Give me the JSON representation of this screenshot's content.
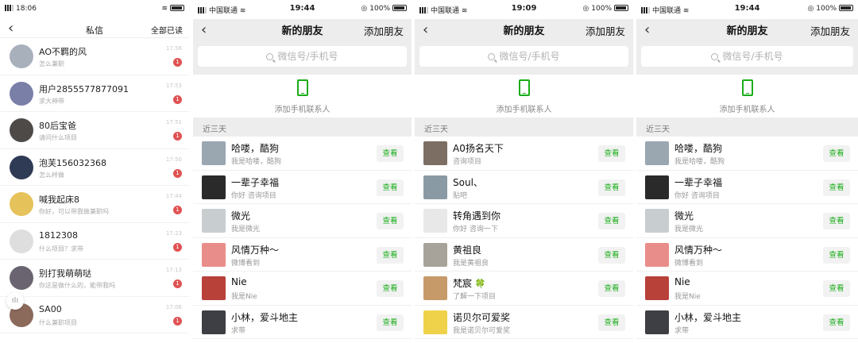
{
  "colors": {
    "wechat_green": "#1aad19",
    "badge_red": "#e05353",
    "section_bg": "#ededed"
  },
  "messages_screen": {
    "status": {
      "time": "18:06",
      "carrier": "4G"
    },
    "title": "私信",
    "back_icon": "chevron-left-icon",
    "mark_all_read": "全部已读",
    "items": [
      {
        "name": "AO不羁的风",
        "subtitle": "怎么兼职",
        "time": "17:56",
        "badge": "1",
        "avatar": "#a8b0bc"
      },
      {
        "name": "用户2855577877091",
        "subtitle": "求大神带",
        "time": "17:53",
        "badge": "1",
        "avatar": "#7a7fa8"
      },
      {
        "name": "80后宝爸",
        "subtitle": "请问什么项目",
        "time": "17:51",
        "badge": "1",
        "avatar": "#4e4a48"
      },
      {
        "name": "泡芙156032368",
        "subtitle": "怎么样做",
        "time": "17:50",
        "badge": "1",
        "avatar": "#2f3a55"
      },
      {
        "name": "喊我起床8",
        "subtitle": "你好，可以带我做兼职吗",
        "time": "17:44",
        "badge": "1",
        "avatar": "#e6c25a"
      },
      {
        "name": "1812308",
        "subtitle": "什么项目？求带",
        "time": "17:23",
        "badge": "1",
        "avatar": "#dedede"
      },
      {
        "name": "别打我萌萌哒",
        "subtitle": "你这是做什么的，能带我吗",
        "time": "17:13",
        "badge": "1",
        "avatar": "#6a6470"
      },
      {
        "name": "SA00",
        "subtitle": "什么兼职项目",
        "time": "17:06",
        "badge": "1",
        "avatar": "#8b6a5c"
      }
    ]
  },
  "new_friends_screens": [
    {
      "status": {
        "carrier": "中国联通",
        "time": "19:44",
        "battery": "100%"
      },
      "title": "新的朋友",
      "add_friend": "添加朋友",
      "search_placeholder": "微信号/手机号",
      "add_contacts": "添加手机联系人",
      "section": "近三天",
      "view_label": "查看",
      "friends": [
        {
          "name": "哈喽，酷狗",
          "note": "我是哈喽，酷狗",
          "avatar": "#9aa6b0"
        },
        {
          "name": "一辈子幸福",
          "note": "你好 咨询项目",
          "avatar": "#2a2a2a"
        },
        {
          "name": "微光",
          "note": "我是微光",
          "avatar": "#c8cdd0"
        },
        {
          "name": "风情万种～",
          "note": "微博看到",
          "avatar": "#e98d8a"
        },
        {
          "name": "Nie",
          "note": "我是Nie",
          "avatar": "#b8413a"
        },
        {
          "name": "小林，爱斗地主",
          "note": "求带",
          "avatar": "#3d3f44"
        }
      ]
    },
    {
      "status": {
        "carrier": "中国联通",
        "time": "19:09",
        "battery": "100%"
      },
      "title": "新的朋友",
      "add_friend": "添加朋友",
      "search_placeholder": "微信号/手机号",
      "add_contacts": "添加手机联系人",
      "section": "近三天",
      "view_label": "查看",
      "friends": [
        {
          "name": "A0扬名天下",
          "note": "咨询项目",
          "avatar": "#7c6e62"
        },
        {
          "name": "Soul、",
          "note": "贴吧",
          "avatar": "#8a9aa4"
        },
        {
          "name": "转角遇到你",
          "note": "你好 咨询一下",
          "avatar": "#e8e8e8"
        },
        {
          "name": "黄祖良",
          "note": "我是黄祖良",
          "avatar": "#a7a39a"
        },
        {
          "name": "梵宸",
          "note": "了解一下项目",
          "avatar": "#c79a6a",
          "emoji": "🍀"
        },
        {
          "name": "诺贝尔可爱奖",
          "note": "我是诺贝尔可爱奖",
          "avatar": "#f0d24a"
        }
      ]
    },
    {
      "status": {
        "carrier": "中国联通",
        "time": "19:44",
        "battery": "100%"
      },
      "title": "新的朋友",
      "add_friend": "添加朋友",
      "search_placeholder": "微信号/手机号",
      "add_contacts": "添加手机联系人",
      "section": "近三天",
      "view_label": "查看",
      "friends": [
        {
          "name": "哈喽，酷狗",
          "note": "我是哈喽，酷狗",
          "avatar": "#9aa6b0"
        },
        {
          "name": "一辈子幸福",
          "note": "你好 咨询项目",
          "avatar": "#2a2a2a"
        },
        {
          "name": "微光",
          "note": "我是微光",
          "avatar": "#c8cdd0"
        },
        {
          "name": "风情万种～",
          "note": "微博看到",
          "avatar": "#e98d8a"
        },
        {
          "name": "Nie",
          "note": "我是Nie",
          "avatar": "#b8413a"
        },
        {
          "name": "小林，爱斗地主",
          "note": "求带",
          "avatar": "#3d3f44"
        }
      ]
    }
  ]
}
